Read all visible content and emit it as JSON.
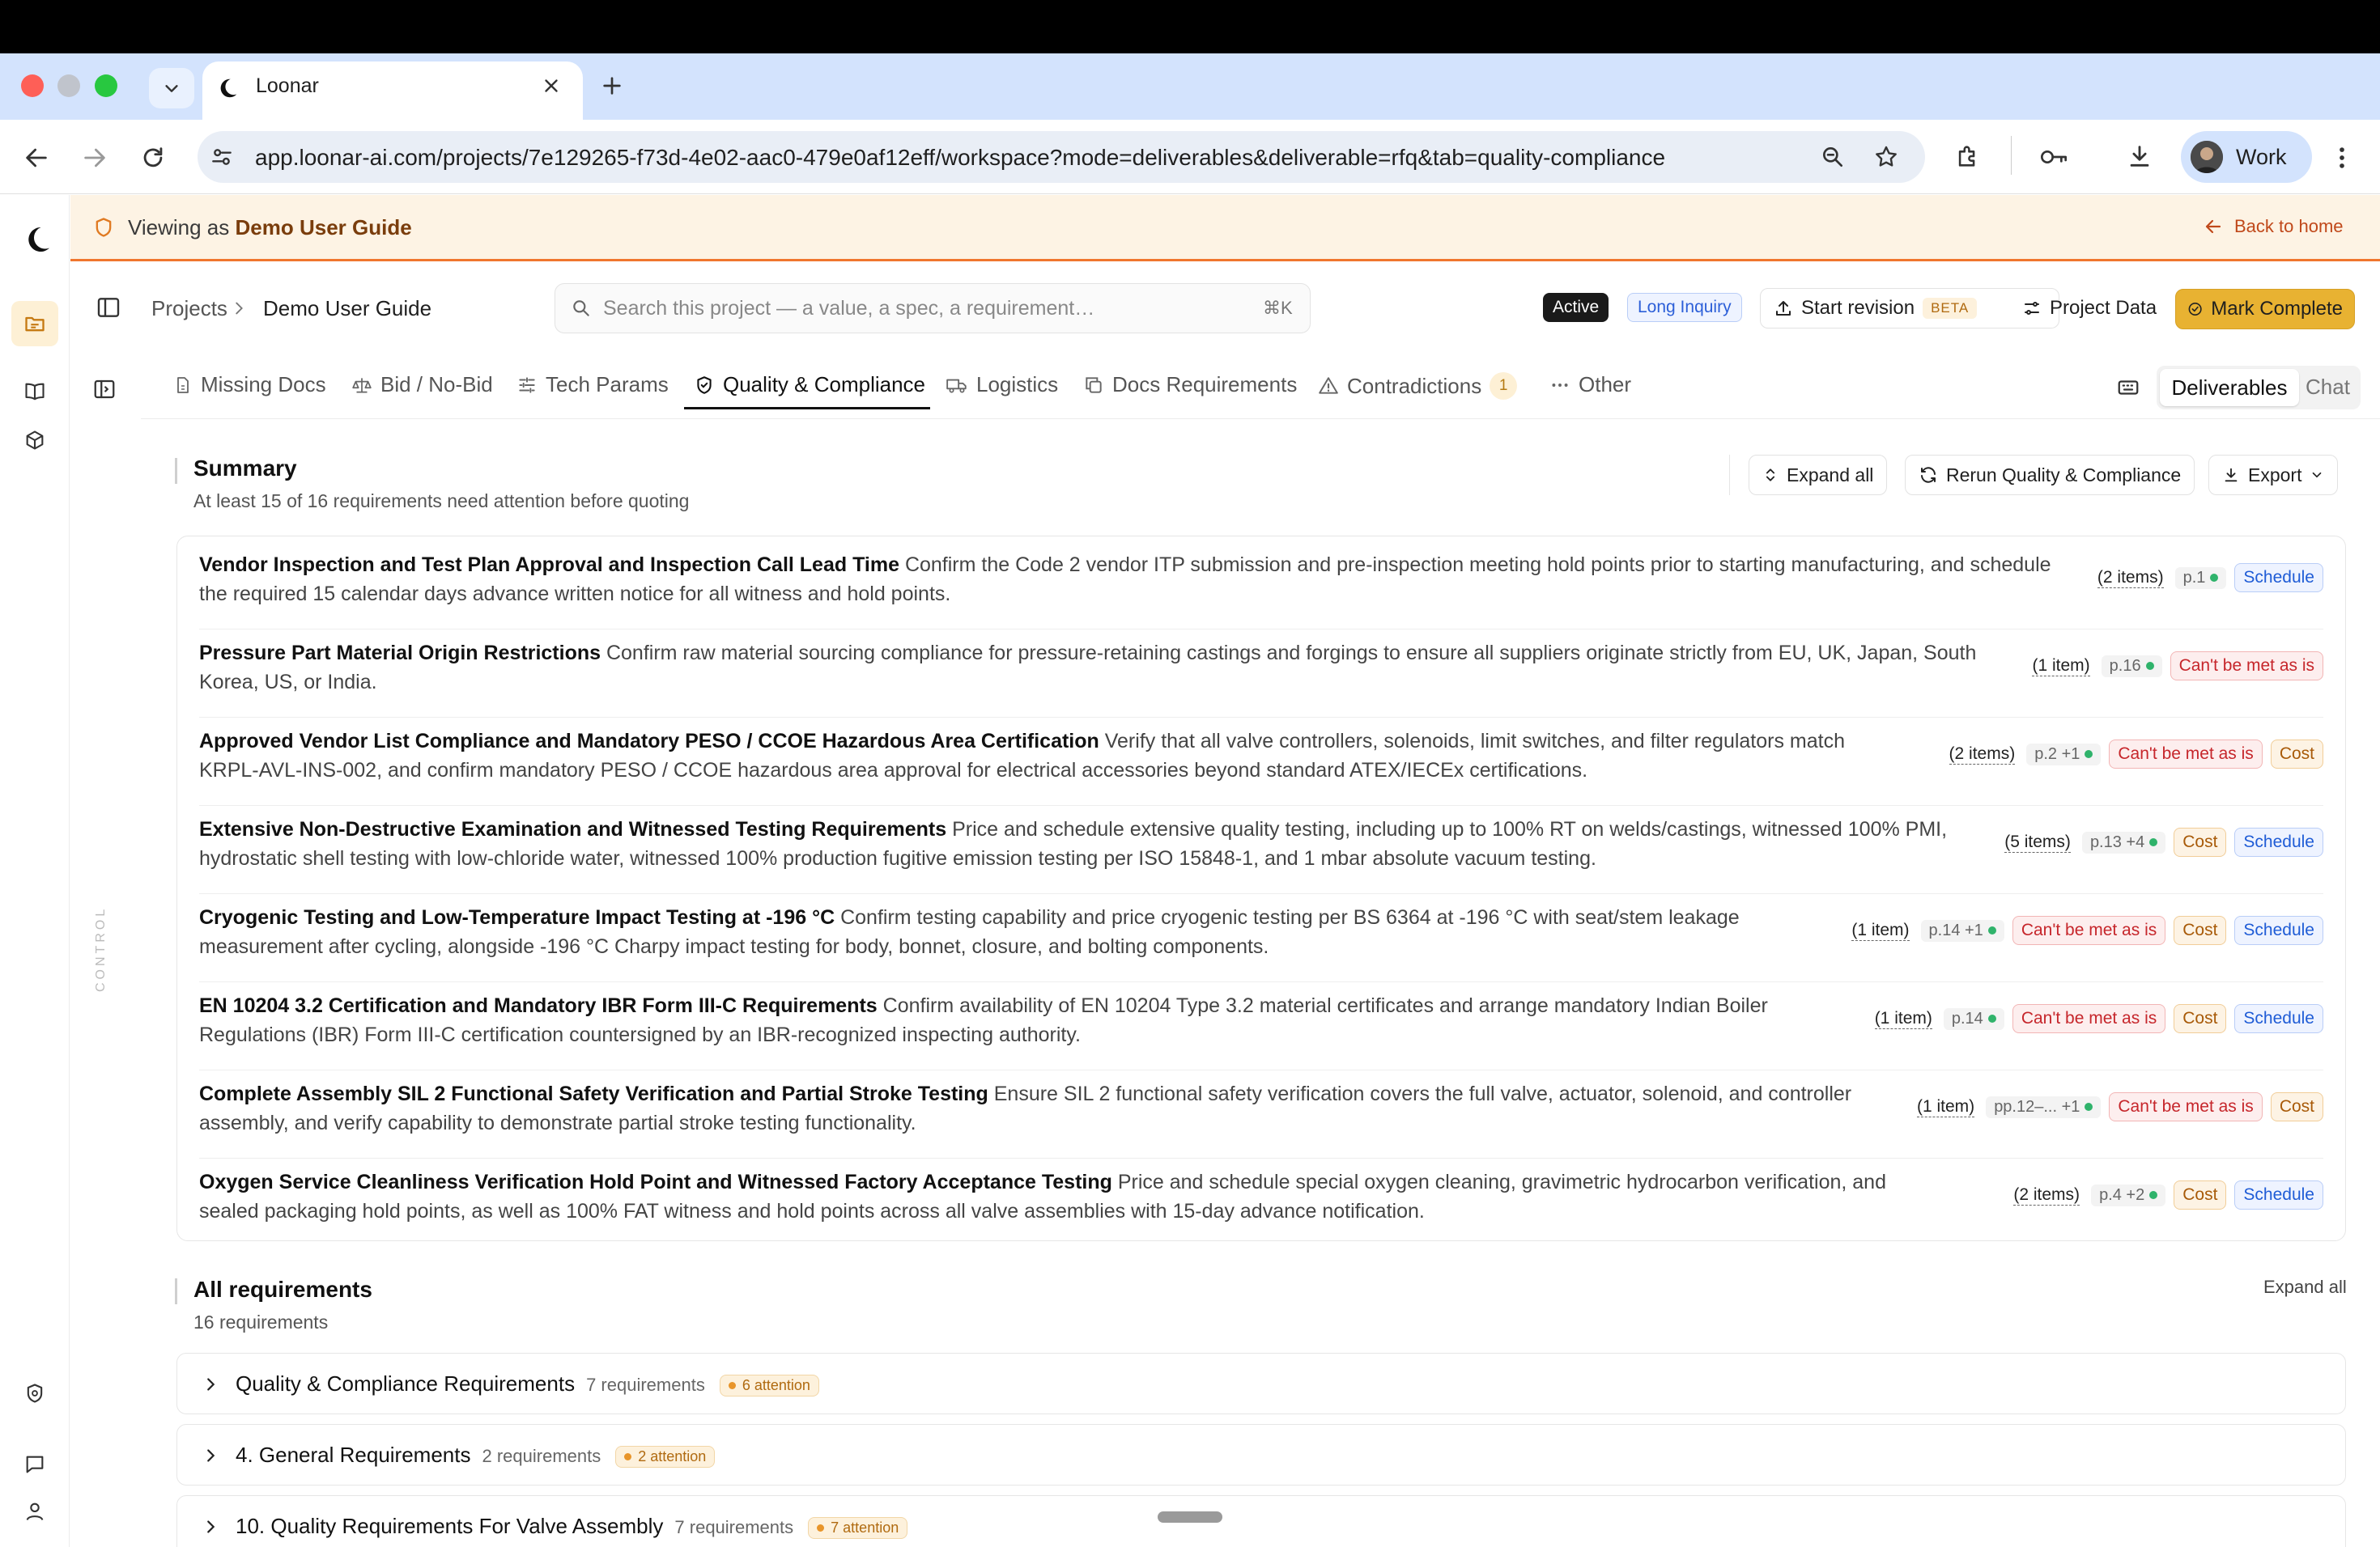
{
  "browser": {
    "tab_title": "Loonar",
    "url": "app.loonar-ai.com/projects/7e129265-f73d-4e02-aac0-479e0af12eff/workspace?mode=deliverables&deliverable=rfq&tab=quality-compliance",
    "profile_name": "Work"
  },
  "banner": {
    "prefix": "Viewing as ",
    "user": "Demo User Guide",
    "back_label": "Back to home"
  },
  "header": {
    "crumb_projects": "Projects",
    "crumb_current": "Demo User Guide",
    "search_placeholder": "Search this project — a value, a spec, a requirement…",
    "search_shortcut": "⌘K",
    "status_pill": "Active",
    "inquiry_pill": "Long Inquiry",
    "start_revision": "Start revision",
    "beta": "BETA",
    "project_data": "Project Data",
    "mark_complete": "Mark Complete"
  },
  "tabs": [
    {
      "label": "Missing Docs",
      "icon": "file-icon"
    },
    {
      "label": "Bid / No-Bid",
      "icon": "scale-icon"
    },
    {
      "label": "Tech Params",
      "icon": "sliders-icon"
    },
    {
      "label": "Quality & Compliance",
      "icon": "shield-check-icon",
      "active": true
    },
    {
      "label": "Logistics",
      "icon": "truck-icon"
    },
    {
      "label": "Docs Requirements",
      "icon": "copy-icon"
    },
    {
      "label": "Contradictions",
      "icon": "warning-icon",
      "badge": "1"
    },
    {
      "label": "Other",
      "icon": "ellipsis-icon"
    }
  ],
  "view_toggle": {
    "deliverables": "Deliverables",
    "chat": "Chat"
  },
  "rail": {
    "control_label": "CONTROL"
  },
  "summary": {
    "title": "Summary",
    "subtitle": "At least 15 of 16 requirements need attention before quoting",
    "expand_all": "Expand all",
    "rerun": "Rerun Quality & Compliance",
    "export": "Export",
    "rows": [
      {
        "title": "Vendor Inspection and Test Plan Approval and Inspection Call Lead Time",
        "desc": "Confirm the Code 2 vendor ITP submission and pre-inspection meeting hold points prior to starting manufacturing, and schedule the required 15 calendar days advance written notice for all witness and hold points.",
        "items": "(2 items)",
        "page": "p.1",
        "tags": [
          "Schedule"
        ]
      },
      {
        "title": "Pressure Part Material Origin Restrictions",
        "desc": "Confirm raw material sourcing compliance for pressure-retaining castings and forgings to ensure all suppliers originate strictly from EU, UK, Japan, South Korea, US, or India.",
        "items": "(1 item)",
        "page": "p.16",
        "tags": [
          "Can't be met as is"
        ]
      },
      {
        "title": "Approved Vendor List Compliance and Mandatory PESO / CCOE Hazardous Area Certification",
        "desc": "Verify that all valve controllers, solenoids, limit switches, and filter regulators match KRPL-AVL-INS-002, and confirm mandatory PESO / CCOE hazardous area approval for electrical accessories beyond standard ATEX/IECEx certifications.",
        "items": "(2 items)",
        "page": "p.2 +1",
        "tags": [
          "Can't be met as is",
          "Cost"
        ]
      },
      {
        "title": "Extensive Non-Destructive Examination and Witnessed Testing Requirements",
        "desc": "Price and schedule extensive quality testing, including up to 100% RT on welds/castings, witnessed 100% PMI, hydrostatic shell testing with low-chloride water, witnessed 100% production fugitive emission testing per ISO 15848-1, and 1 mbar absolute vacuum testing.",
        "items": "(5 items)",
        "page": "p.13 +4",
        "tags": [
          "Cost",
          "Schedule"
        ]
      },
      {
        "title": "Cryogenic Testing and Low-Temperature Impact Testing at -196 °C",
        "desc": "Confirm testing capability and price cryogenic testing per BS 6364 at -196 °C with seat/stem leakage measurement after cycling, alongside -196 °C Charpy impact testing for body, bonnet, closure, and bolting components.",
        "items": "(1 item)",
        "page": "p.14 +1",
        "tags": [
          "Can't be met as is",
          "Cost",
          "Schedule"
        ]
      },
      {
        "title": "EN 10204 3.2 Certification and Mandatory IBR Form III-C Requirements",
        "desc": "Confirm availability of EN 10204 Type 3.2 material certificates and arrange mandatory Indian Boiler Regulations (IBR) Form III-C certification countersigned by an IBR-recognized inspecting authority.",
        "items": "(1 item)",
        "page": "p.14",
        "tags": [
          "Can't be met as is",
          "Cost",
          "Schedule"
        ]
      },
      {
        "title": "Complete Assembly SIL 2 Functional Safety Verification and Partial Stroke Testing",
        "desc": "Ensure SIL 2 functional safety verification covers the full valve, actuator, solenoid, and controller assembly, and verify capability to demonstrate partial stroke testing functionality.",
        "items": "(1 item)",
        "page": "pp.12–... +1",
        "tags": [
          "Can't be met as is",
          "Cost"
        ]
      },
      {
        "title": "Oxygen Service Cleanliness Verification Hold Point and Witnessed Factory Acceptance Testing",
        "desc": "Price and schedule special oxygen cleaning, gravimetric hydrocarbon verification, and sealed packaging hold points, as well as 100% FAT witness and hold points across all valve assemblies with 15-day advance notification.",
        "items": "(2 items)",
        "page": "p.4 +2",
        "tags": [
          "Cost",
          "Schedule"
        ]
      }
    ]
  },
  "all_requirements": {
    "title": "All requirements",
    "subtitle": "16 requirements",
    "expand_all": "Expand all",
    "groups": [
      {
        "title": "Quality & Compliance Requirements",
        "count": "7 requirements",
        "attention": "6 attention"
      },
      {
        "title": "4. General Requirements",
        "count": "2 requirements",
        "attention": "2 attention"
      },
      {
        "title": "10. Quality Requirements For Valve Assembly",
        "count": "7 requirements",
        "attention": "7 attention"
      }
    ]
  }
}
